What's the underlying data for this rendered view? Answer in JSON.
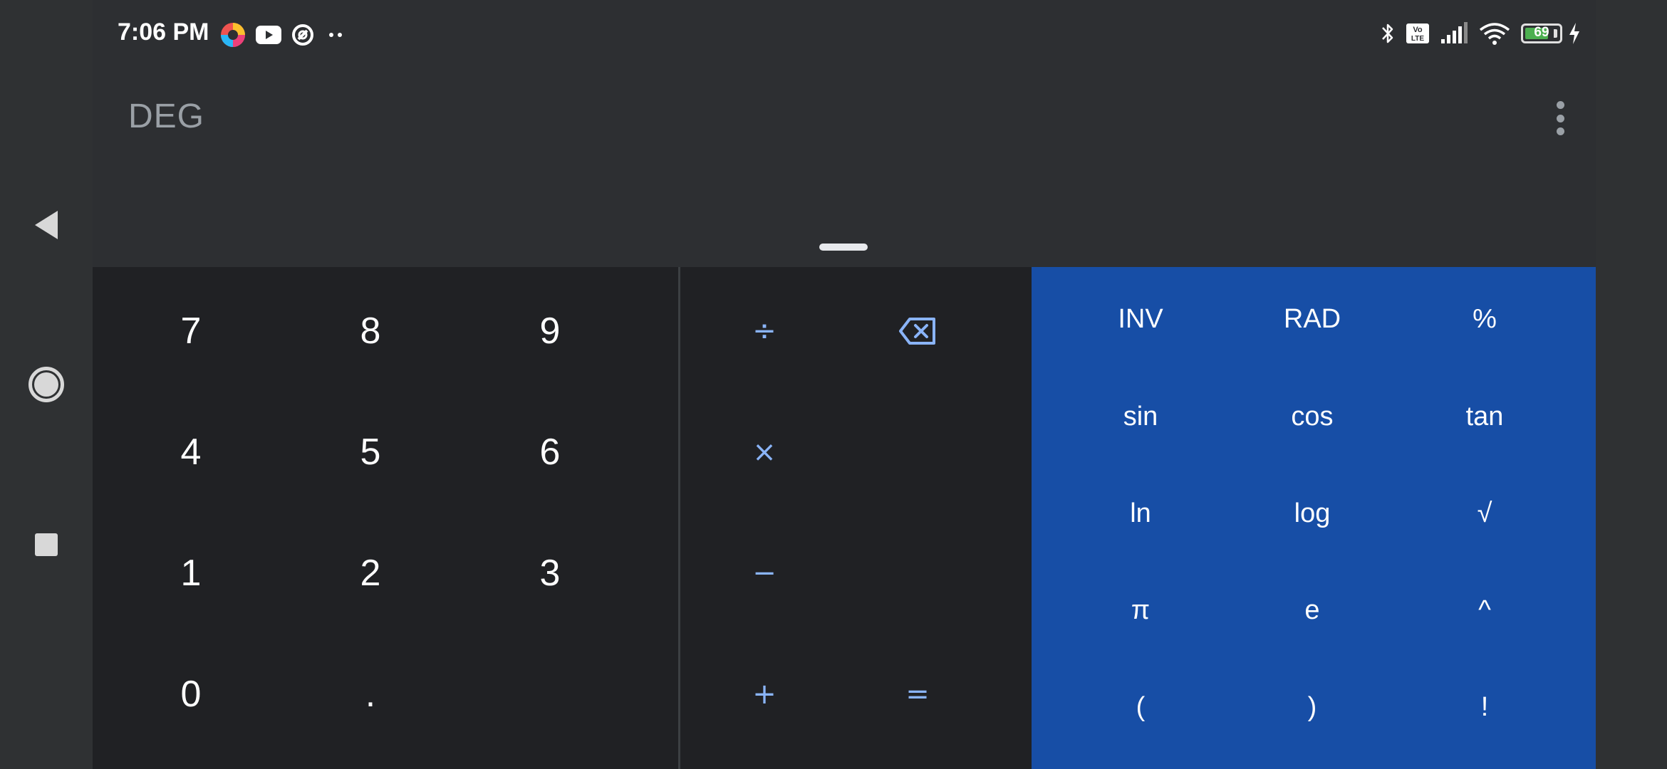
{
  "status_bar": {
    "time": "7:06 PM",
    "battery_level": 69,
    "battery_text": "69",
    "left_icons": [
      "browser-app-icon",
      "youtube-icon",
      "vpn-icon",
      "more-notifications-icon"
    ],
    "right_icons": [
      "bluetooth-icon",
      "volte-icon",
      "cell-signal-icon",
      "wifi-icon",
      "battery-icon",
      "charging-icon"
    ]
  },
  "display": {
    "angle_mode": "DEG"
  },
  "digits": {
    "seven": "7",
    "eight": "8",
    "nine": "9",
    "four": "4",
    "five": "5",
    "six": "6",
    "one": "1",
    "two": "2",
    "three": "3",
    "zero": "0",
    "decimal": "."
  },
  "operators": {
    "divide": "÷",
    "multiply": "×",
    "minus": "−",
    "plus": "+",
    "equals": "="
  },
  "scientific": {
    "inv": "INV",
    "rad": "RAD",
    "percent": "%",
    "sin": "sin",
    "cos": "cos",
    "tan": "tan",
    "ln": "ln",
    "log": "log",
    "sqrt": "√",
    "pi": "π",
    "e": "e",
    "power": "^",
    "lparen": "(",
    "rparen": ")",
    "factorial": "!"
  },
  "colors": {
    "display_bg": "#2d2f32",
    "keypad_bg": "#202124",
    "scientific_bg": "#174ea6",
    "operator_text": "#8ab4f8",
    "battery_fill": "#4caf50"
  },
  "nav": {
    "icons": [
      "back-icon",
      "home-icon",
      "recents-icon"
    ]
  }
}
